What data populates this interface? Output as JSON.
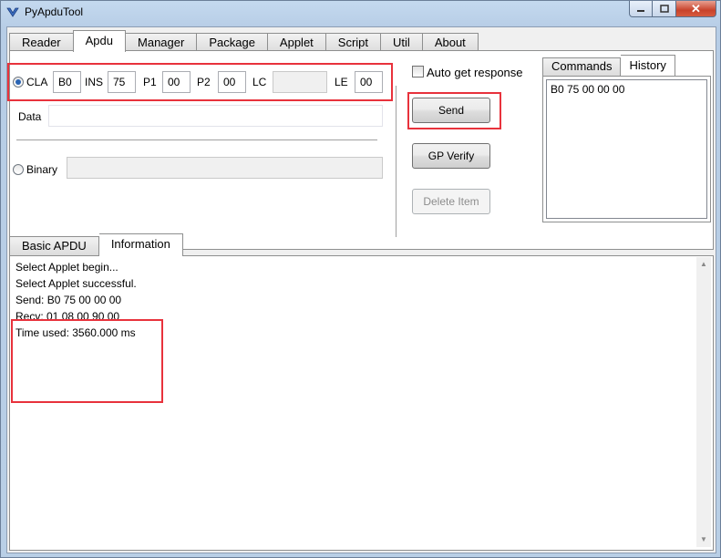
{
  "window": {
    "title": "PyApduTool"
  },
  "main_tabs": [
    "Reader",
    "Apdu",
    "Manager",
    "Package",
    "Applet",
    "Script",
    "Util",
    "About"
  ],
  "apdu": {
    "cla_label": "CLA",
    "cla": "B0",
    "ins_label": "INS",
    "ins": "75",
    "p1_label": "P1",
    "p1": "00",
    "p2_label": "P2",
    "p2": "00",
    "lc_label": "LC",
    "lc": "",
    "le_label": "LE",
    "le": "00",
    "data_label": "Data",
    "data": "",
    "binary_label": "Binary",
    "binary": ""
  },
  "actions": {
    "auto_get_response": "Auto get response",
    "send": "Send",
    "gp_verify": "GP Verify",
    "delete_item": "Delete Item"
  },
  "side_tabs": [
    "Commands",
    "History"
  ],
  "history": [
    "B0 75 00 00 00"
  ],
  "bottom_tabs": [
    "Basic APDU",
    "Information"
  ],
  "log": [
    "Select Applet begin...",
    "Select Applet successful.",
    "Send: B0 75 00 00 00",
    "Recv: 01 08 00 90 00",
    "Time used: 3560.000 ms"
  ],
  "colors": {
    "highlight": "#e8323c",
    "radio_dot": "#2a64b4"
  }
}
